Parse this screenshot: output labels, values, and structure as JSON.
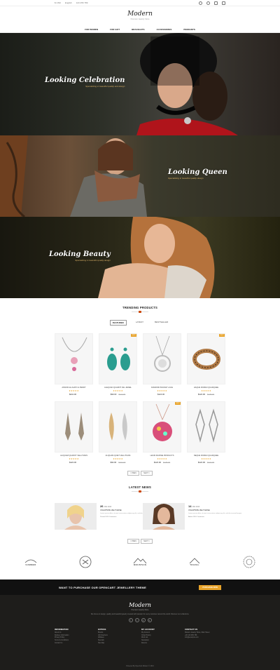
{
  "topbar": {
    "currency": "$ USD",
    "language": "English",
    "phone": "123 456 789"
  },
  "header": {
    "logo": "Modern",
    "tagline": "Premium Jewelry Store"
  },
  "nav": [
    "FOR WOMEN",
    "FOR GIFT",
    "BRACELETS",
    "ACCESSORIES",
    "PENDANTS"
  ],
  "heroes": [
    {
      "title": "Looking Celebration",
      "subtitle": "Specializing in beautiful quality and design"
    },
    {
      "title": "Looking Queen",
      "subtitle": "Specializing in beautiful quality design"
    },
    {
      "title": "Looking Beauty",
      "subtitle": "Specializing in beautiful quality design"
    }
  ],
  "trending": {
    "title": "TRENDING PRODUCTS",
    "tabs": [
      "FEATURED",
      "LATEST",
      "BESTSELLER"
    ]
  },
  "products": [
    {
      "name": "ANNOR ALLIGATO & PENDT",
      "price": "$241.00",
      "old": "",
      "sale": false
    },
    {
      "name": "ALEQUAN QUARNT VEL JEWEL",
      "price": "$90.00",
      "old": "$110.00",
      "sale": true
    },
    {
      "name": "DIAMOND BUCKET LACE",
      "price": "$124.00",
      "old": "",
      "sale": false
    },
    {
      "name": "HAQUE ROMAN QUARQUEE",
      "price": "$124.00",
      "old": "$145.00",
      "sale": true
    },
    {
      "name": "ALIQUAM QUAROT VELLITIANS",
      "price": "$122.00",
      "old": "",
      "sale": false
    },
    {
      "name": "ALIQUAM QUIET VELLITIANS",
      "price": "$92.00",
      "old": "$102.00",
      "sale": false
    },
    {
      "name": "HAUM MAXIME PRODUCTS",
      "price": "$124.00",
      "old": "$145.00",
      "sale": true
    },
    {
      "name": "NEQUE ROMAN QUARQUEE",
      "price": "$124.00",
      "old": "$221.00",
      "sale": false
    }
  ],
  "pager": {
    "prev": "< PREV",
    "next": "NEXT >"
  },
  "latest_news": {
    "title": "LATEST NEWS",
    "items": [
      {
        "day": "26",
        "month": "JAN 2016",
        "title": "VOLUPTATE VELIT ESSE",
        "text": "Lorem ipsum dolor sit amet consectetur adipiscing elit, sed do eiusmod tempor",
        "meta": "Posted 2016  Comments"
      },
      {
        "day": "14",
        "month": "JAN 2016",
        "title": "VOLUPTATE VELIT ESSE",
        "text": "Lorem ipsum dolor sit amet consectetur adipiscing elit, sed do eiusmod tempor",
        "meta": "Admin 2016  Comments"
      }
    ]
  },
  "brands": [
    "SUMMER",
    "MOUNTAIN",
    "TRAVEL"
  ],
  "cta": {
    "text": "WANT TO PURCHASE OUR OPENCART JEWELLERY THEME",
    "button": "PURCHASE NOW"
  },
  "footer": {
    "logo": "Modern",
    "tagline": "Premium Jewelry Store",
    "text": "We focus on design, quality and beautiful jewelry created with passion for every customer around the world. Discover our collections.",
    "socials": [
      "f",
      "t",
      "g",
      "p"
    ],
    "columns": [
      {
        "title": "INFORMATION",
        "items": [
          "About Us",
          "Delivery Information",
          "Privacy Policy",
          "Terms & Conditions",
          "Contact Us"
        ]
      },
      {
        "title": "EXTRAS",
        "items": [
          "Brands",
          "Gift Vouchers",
          "Affiliates",
          "Specials",
          "Site Map"
        ]
      },
      {
        "title": "MY ACCOUNT",
        "items": [
          "My Account",
          "Order History",
          "Wish List",
          "Newsletter",
          "Returns"
        ]
      },
      {
        "title": "CONTACT US",
        "items": [
          "Modern Jewelry Store, Main Street",
          "+00 123 456 789",
          "info@example.com"
        ]
      }
    ],
    "copyright": "Powered By OpenCart Modern © 2016"
  },
  "colors": {
    "accent": "#e8a32a",
    "dark": "#111111",
    "footer": "#1e1d1b"
  }
}
